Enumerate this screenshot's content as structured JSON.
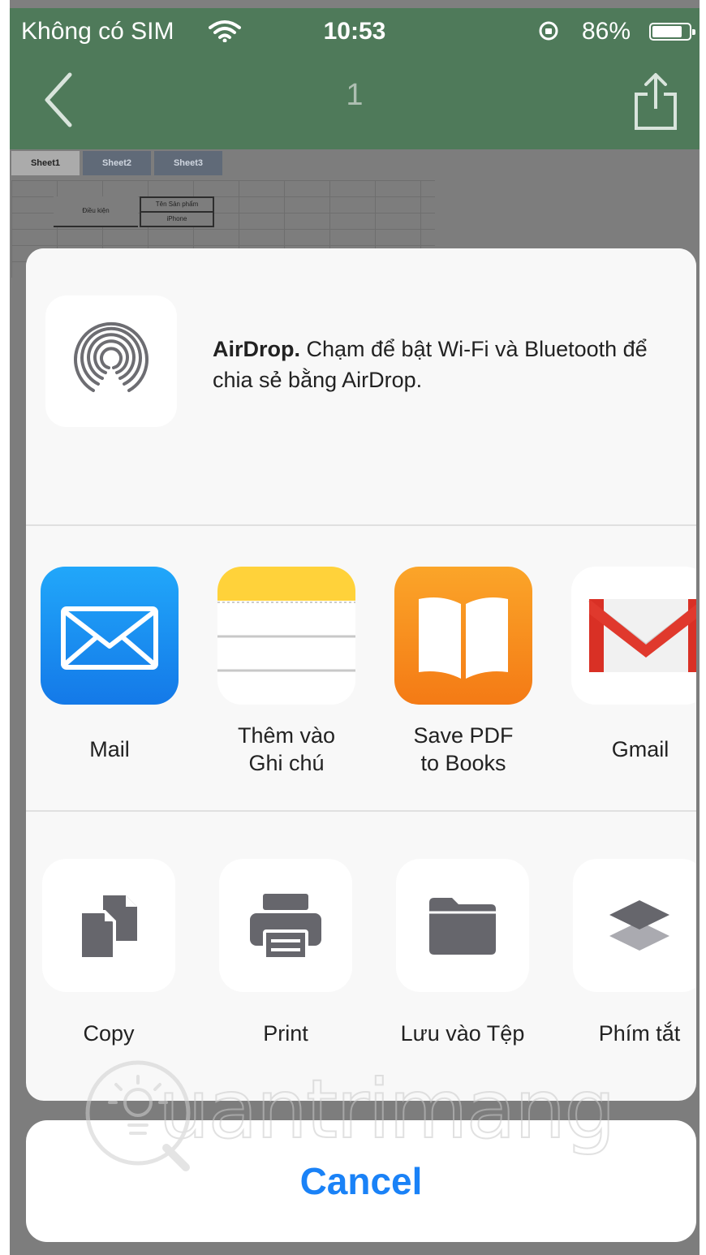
{
  "status_bar": {
    "carrier": "Không có SIM",
    "time": "10:53",
    "battery_percent": "86%",
    "battery_level": 0.86
  },
  "nav_bar": {
    "title": "1"
  },
  "spreadsheet": {
    "tabs": [
      "Sheet1",
      "Sheet2",
      "Sheet3"
    ],
    "active_tab": "Sheet1",
    "cells": {
      "condition": "Điều kiện",
      "product_name": "Tên Sản phẩm",
      "product_value": "iPhone"
    }
  },
  "share_sheet": {
    "airdrop": {
      "title": "AirDrop.",
      "message": " Chạm để bật Wi-Fi và Bluetooth để chia sẻ bằng AirDrop."
    },
    "apps": [
      {
        "label": "Mail",
        "icon": "mail-icon"
      },
      {
        "label": "Thêm vào Ghi chú",
        "icon": "notes-icon"
      },
      {
        "label": "Save PDF to Books",
        "icon": "books-icon"
      },
      {
        "label": "Gmail",
        "icon": "gmail-icon"
      }
    ],
    "actions": [
      {
        "label": "Copy",
        "icon": "copy-icon"
      },
      {
        "label": "Print",
        "icon": "print-icon"
      },
      {
        "label": "Lưu vào Tệp",
        "icon": "folder-icon"
      },
      {
        "label": "Phím tắt",
        "icon": "shortcuts-icon"
      }
    ],
    "cancel_label": "Cancel"
  },
  "watermark": {
    "text": "uantrimang"
  },
  "colors": {
    "nav_green": "#4f7a5a",
    "cancel_blue": "#1a82f7",
    "mail_blue": "#1a8cf0",
    "books_orange": "#f7921e",
    "notes_yellow": "#ffd23a",
    "gmail_red": "#d93025"
  }
}
